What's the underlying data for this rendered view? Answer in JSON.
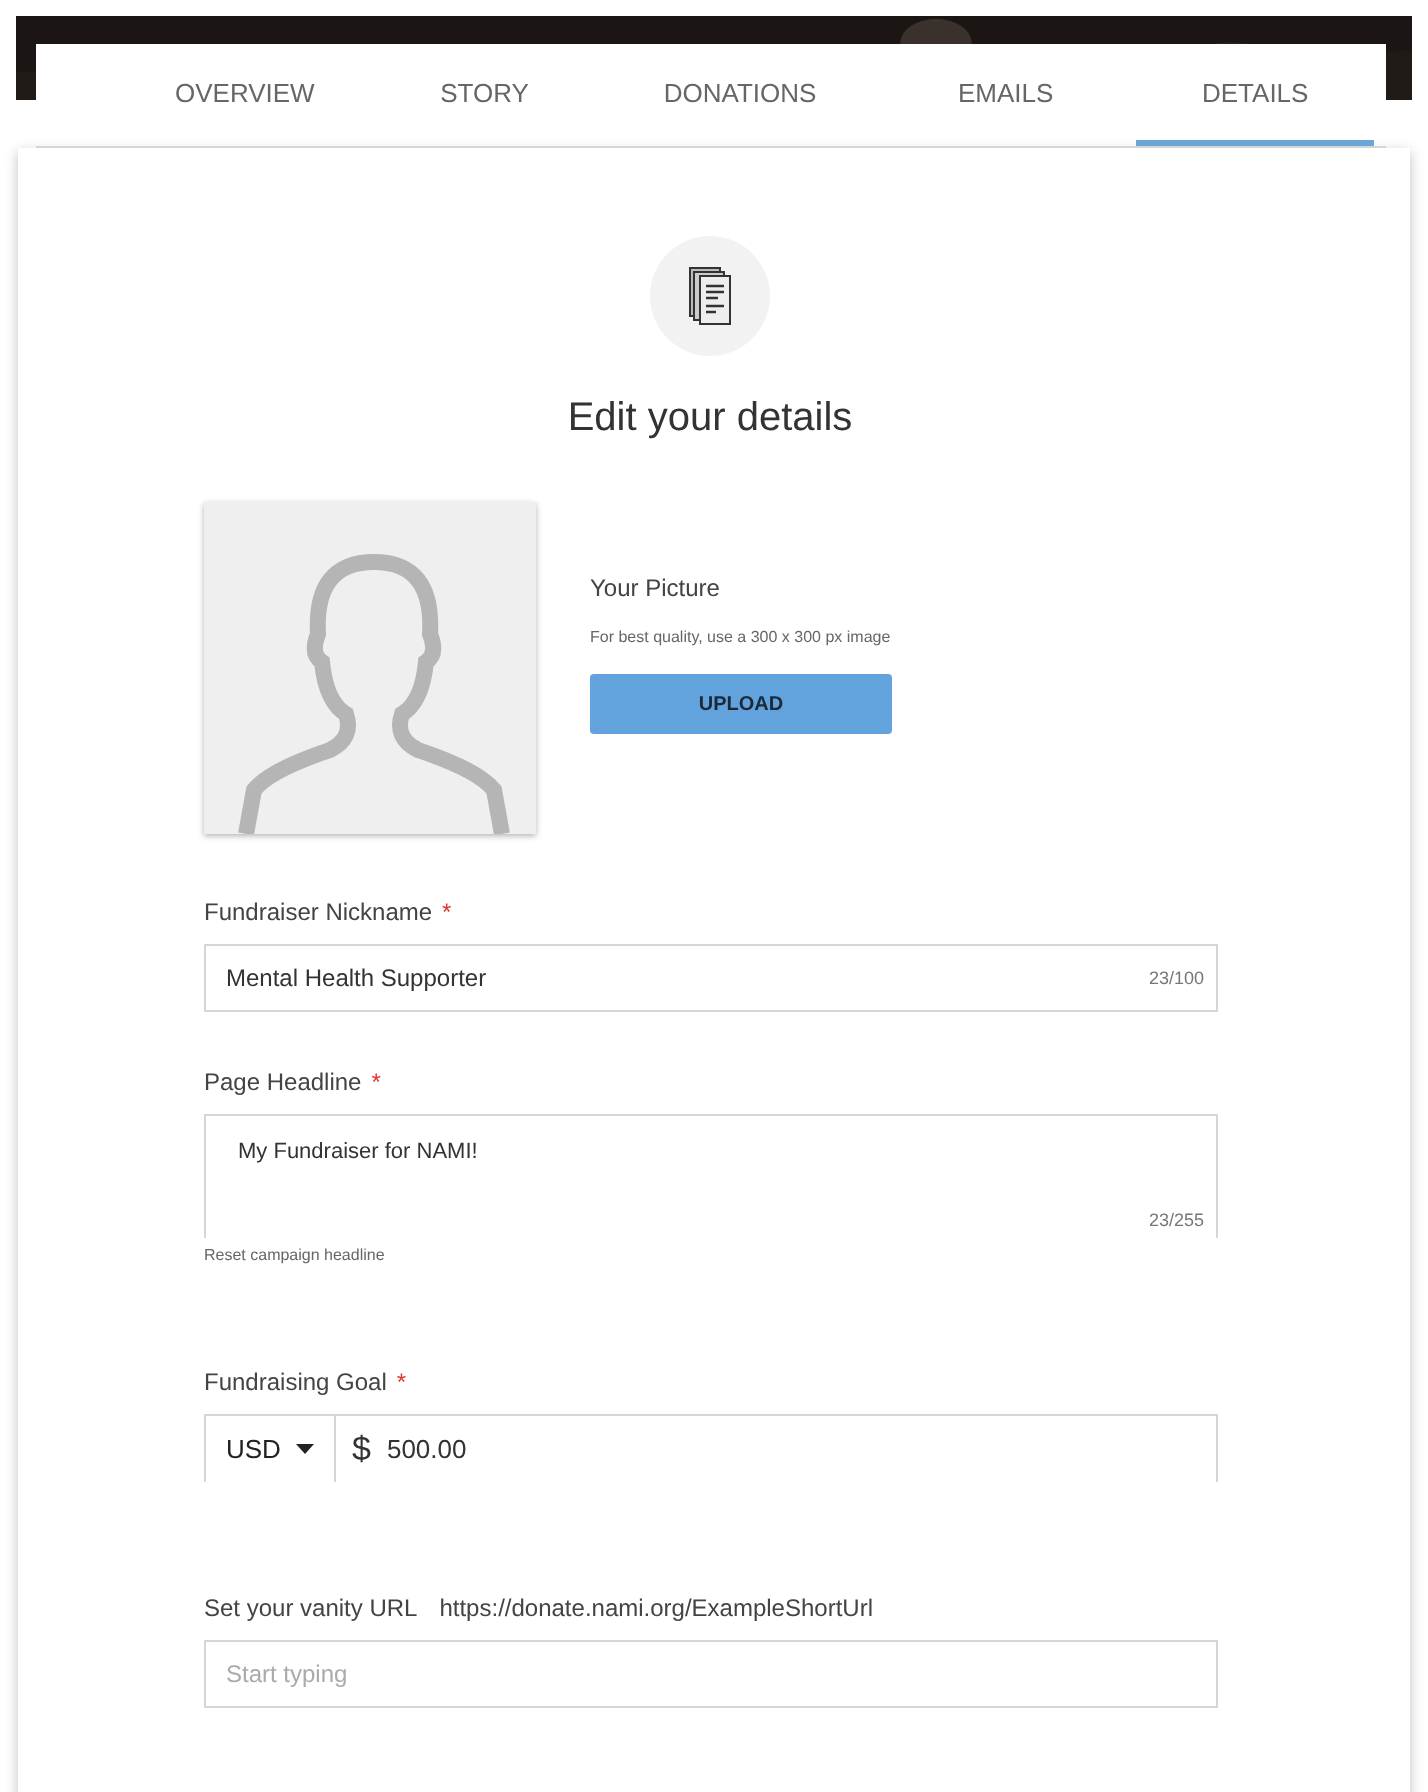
{
  "tabs": [
    {
      "label": "OVERVIEW",
      "selected": false
    },
    {
      "label": "STORY",
      "selected": false
    },
    {
      "label": "DONATIONS",
      "selected": false
    },
    {
      "label": "EMAILS",
      "selected": false
    },
    {
      "label": "DETAILS",
      "selected": true
    }
  ],
  "heading": "Edit your details",
  "picture": {
    "title": "Your Picture",
    "hint": "For best quality, use a 300 x 300 px image",
    "button": "UPLOAD"
  },
  "fields": [
    {
      "kind": "text",
      "label": "Fundraiser Nickname",
      "required_mark": "*",
      "value": "Mental Health Supporter",
      "counter": "23/100"
    },
    {
      "kind": "textarea",
      "label": "Page Headline",
      "required_mark": "*",
      "value": "My Fundraiser for NAMI!",
      "counter": "23/255",
      "link": "Reset campaign headline"
    },
    {
      "kind": "money",
      "label": "Fundraising Goal",
      "required_mark": "*",
      "currency": "USD",
      "symbol": "$",
      "value": "500.00"
    },
    {
      "kind": "url",
      "label": "Set your vanity URL",
      "url": "https://donate.nami.org/ExampleShortUrl",
      "placeholder": "Start typing"
    }
  ]
}
